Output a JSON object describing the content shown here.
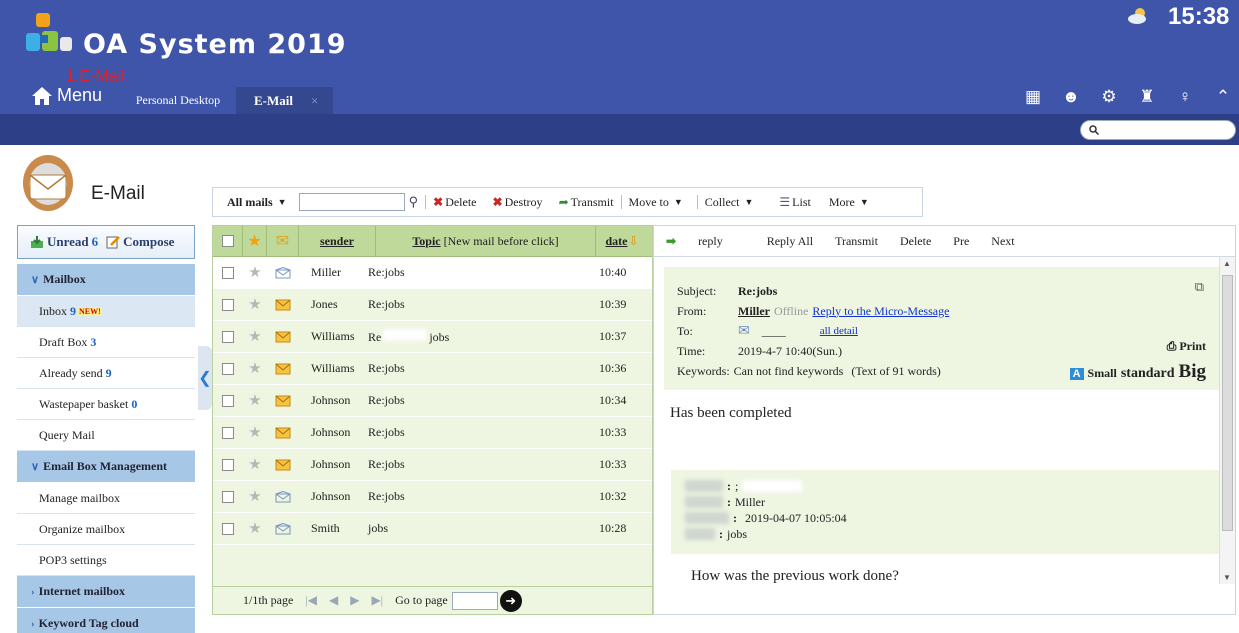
{
  "header": {
    "app_title": "OA System 2019",
    "annotation": "1.E-Mail",
    "menu_label": "Menu",
    "tabs": [
      {
        "label": "Personal Desktop"
      },
      {
        "label": "E-Mail",
        "close": "×"
      }
    ],
    "clock": "15:38",
    "tool_icons": [
      "apps-icon",
      "users-icon",
      "gear-icon",
      "shirt-icon",
      "key-icon",
      "collapse-icon"
    ],
    "search_placeholder": ""
  },
  "module": {
    "title": "E-Mail",
    "unread_label": "Unread",
    "unread_count": "6",
    "compose_label": "Compose"
  },
  "nav": {
    "mailbox_group": "Mailbox",
    "items": [
      {
        "label": "Inbox",
        "count": "9",
        "badge": "NEW!"
      },
      {
        "label": "Draft Box",
        "count": "3"
      },
      {
        "label": "Already send",
        "count": "9"
      },
      {
        "label": "Wastepaper basket",
        "count": "0"
      },
      {
        "label": "Query Mail"
      }
    ],
    "management_group": "Email Box Management",
    "management_items": [
      "Manage mailbox",
      "Organize mailbox",
      "POP3 settings"
    ],
    "internet_group": "Internet mailbox",
    "keyword_group": "Keyword Tag cloud"
  },
  "toolbar": {
    "filter": "All mails",
    "search_value": "",
    "delete": "Delete",
    "destroy": "Destroy",
    "transmit": "Transmit",
    "move_to": "Move to",
    "collect": "Collect",
    "list": "List",
    "more": "More"
  },
  "list": {
    "col_sender": "sender",
    "col_topic": "Topic",
    "col_topic_hint": "[New mail before click]",
    "col_date": "date",
    "rows": [
      {
        "sender": "Miller",
        "topic": "Re:jobs",
        "date": "10:40",
        "read": true
      },
      {
        "sender": "Jones",
        "topic": "Re:jobs",
        "date": "10:39",
        "read": false
      },
      {
        "sender": "Williams",
        "topic": "Re",
        "topic_tail": "jobs",
        "date": "10:37",
        "read": false
      },
      {
        "sender": "Williams",
        "topic": "Re:jobs",
        "date": "10:36",
        "read": false
      },
      {
        "sender": "Johnson",
        "topic": "Re:jobs",
        "date": "10:34",
        "read": false
      },
      {
        "sender": "Johnson",
        "topic": "Re:jobs",
        "date": "10:33",
        "read": false
      },
      {
        "sender": "Johnson",
        "topic": "Re:jobs",
        "date": "10:33",
        "read": false
      },
      {
        "sender": "Johnson",
        "topic": "Re:jobs",
        "date": "10:32",
        "read": true
      },
      {
        "sender": "Smith",
        "topic": "jobs",
        "date": "10:28",
        "read": true
      }
    ],
    "page_info": "1/1th page",
    "goto_label": "Go to page",
    "goto_value": ""
  },
  "reader": {
    "actions": [
      "reply",
      "Reply All",
      "Transmit",
      "Delete",
      "Pre",
      "Next"
    ],
    "subject_label": "Subject:",
    "subject": "Re:jobs",
    "from_label": "From:",
    "from_name": "Miller",
    "from_status": "Offline",
    "reply_link": "Reply to the Micro-Message",
    "to_label": "To:",
    "to_value": "____",
    "all_detail": "all detail",
    "time_label": "Time:",
    "time": "2019-4-7 10:40(Sun.)",
    "keywords_label": "Keywords:",
    "keywords": "Can not find keywords",
    "word_count": "(Text of 91 words)",
    "print": "Print",
    "size_small": "Small",
    "size_standard": "standard",
    "size_big": "Big",
    "body": "Has been completed",
    "quoted": {
      "line1_value": ";",
      "line2_value": "Miller",
      "line3_value": "2019-04-07 10:05:04",
      "line4_value": "jobs"
    },
    "quoted_body": "How was the previous work done?"
  },
  "colors": {
    "header_bg": "#3f55a9",
    "header_subbar": "#2d3f86",
    "list_bg": "#eef5e1",
    "list_head": "#bfd99b",
    "nav_group": "#a6c8e6",
    "link": "#1232c9",
    "count": "#1a64c4"
  }
}
